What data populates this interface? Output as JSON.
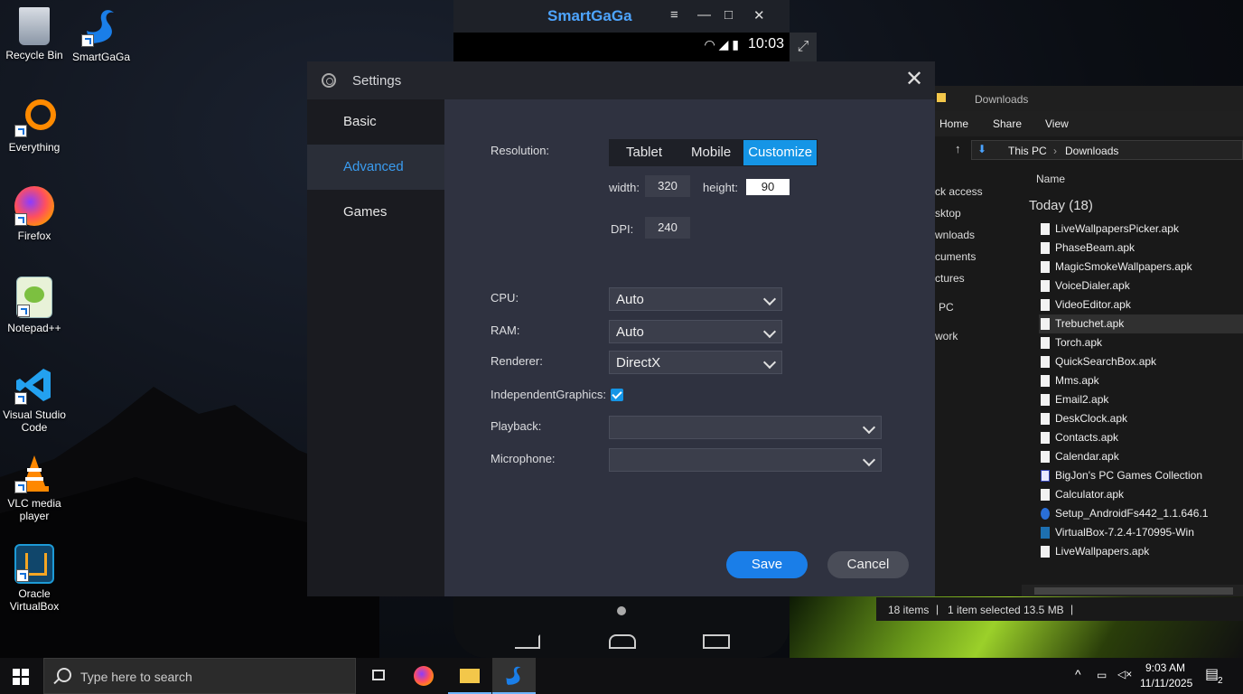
{
  "desktop": {
    "icons": [
      {
        "label": "Recycle Bin"
      },
      {
        "label": "SmartGaGa"
      },
      {
        "label": "Everything"
      },
      {
        "label": "Firefox"
      },
      {
        "label": "Notepad++"
      },
      {
        "label": "Visual Studio Code"
      },
      {
        "label": "VLC media player"
      },
      {
        "label": "Oracle VirtualBox"
      }
    ]
  },
  "emulator": {
    "app_name": "SmartGaGa",
    "status_time": "10:03",
    "controls": {
      "menu": "≡",
      "minimize": "—",
      "maximize": "□",
      "close": "✕"
    }
  },
  "settings": {
    "title": "Settings",
    "tabs": [
      {
        "label": "Basic"
      },
      {
        "label": "Advanced"
      },
      {
        "label": "Games"
      }
    ],
    "active_tab": "Advanced",
    "resolution": {
      "label": "Resolution:",
      "options": [
        "Tablet",
        "Mobile",
        "Customize"
      ],
      "selected": "Customize",
      "width_label": "width:",
      "width_value": "320",
      "height_label": "height:",
      "height_value": "90",
      "dpi_label": "DPI:",
      "dpi_value": "240"
    },
    "cpu": {
      "label": "CPU:",
      "value": "Auto"
    },
    "ram": {
      "label": "RAM:",
      "value": "Auto"
    },
    "renderer": {
      "label": "Renderer:",
      "value": "DirectX"
    },
    "independent_graphics": {
      "label": "IndependentGraphics:",
      "checked": true
    },
    "playback": {
      "label": "Playback:",
      "value": ""
    },
    "microphone": {
      "label": "Microphone:",
      "value": ""
    },
    "save_label": "Save",
    "cancel_label": "Cancel",
    "accent": "#1595e6"
  },
  "explorer": {
    "title": "Downloads",
    "menu": [
      "Home",
      "Share",
      "View"
    ],
    "breadcrumb": [
      "This PC",
      "Downloads"
    ],
    "nav": [
      "ck access",
      "sktop",
      "wnloads",
      "cuments",
      "ctures",
      "PC",
      "work"
    ],
    "column_name": "Name",
    "group_label": "Today (18)",
    "files": [
      "LiveWallpapersPicker.apk",
      "PhaseBeam.apk",
      "MagicSmokeWallpapers.apk",
      "VoiceDialer.apk",
      "VideoEditor.apk",
      "Trebuchet.apk",
      "Torch.apk",
      "QuickSearchBox.apk",
      "Mms.apk",
      "Email2.apk",
      "DeskClock.apk",
      "Contacts.apk",
      "Calendar.apk",
      "BigJon's PC Games Collection",
      "Calculator.apk",
      "Setup_AndroidFs442_1.1.646.1",
      "VirtualBox-7.2.4-170995-Win",
      "LiveWallpapers.apk"
    ],
    "selected_file": "Trebuchet.apk",
    "status_items": "18 items",
    "status_selected": "1 item selected",
    "status_size": "13.5 MB"
  },
  "taskbar": {
    "search_placeholder": "Type here to search",
    "time": "9:03 AM",
    "date": "11/11/2025",
    "notification_count": "2"
  }
}
